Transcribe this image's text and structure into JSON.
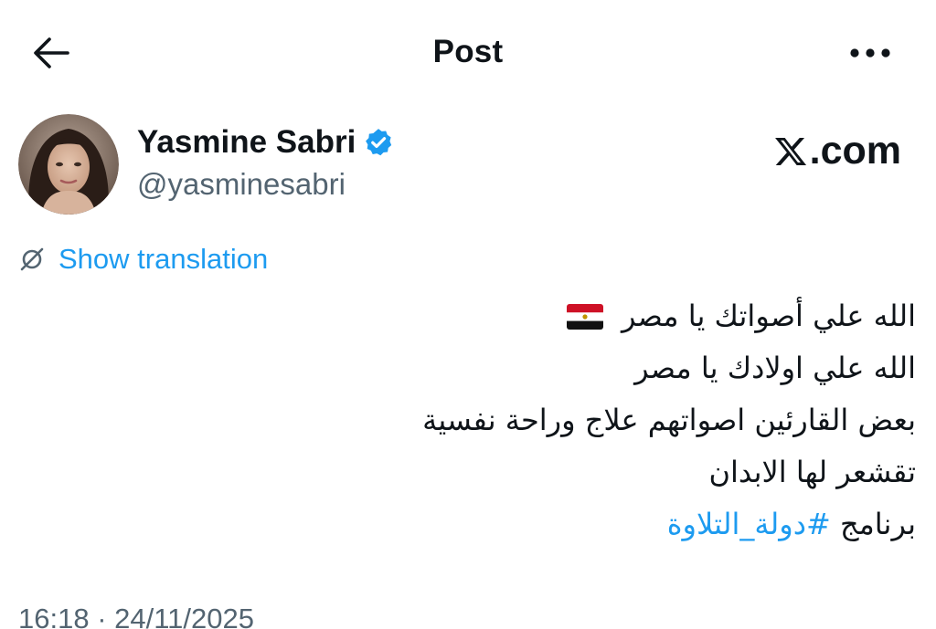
{
  "header": {
    "title": "Post",
    "back_icon": "arrow-left-icon",
    "more_icon": "more-horizontal-icon"
  },
  "author": {
    "name": "Yasmine Sabri",
    "handle": "@yasminesabri",
    "verified": true,
    "verified_color": "#1d9bf0"
  },
  "watermark": {
    "logo": "x-logo-icon",
    "text": ".com"
  },
  "translation": {
    "label": "Show translation",
    "icon": "translate-icon"
  },
  "post": {
    "line1_text": "الله علي أصواتك يا مصر",
    "line1_emoji": "egypt-flag",
    "line2": "الله علي اولادك يا مصر",
    "line3": "بعض القارئين اصواتهم علاج وراحة نفسية",
    "line4": "تقشعر لها الابدان",
    "line5_prefix": "برنامج",
    "line5_hashtag": "#دولة_التلاوة"
  },
  "meta": {
    "timestamp": "16:18 · 24/11/2025"
  },
  "colors": {
    "accent": "#1d9bf0",
    "text": "#0f1419",
    "secondary": "#536471"
  }
}
